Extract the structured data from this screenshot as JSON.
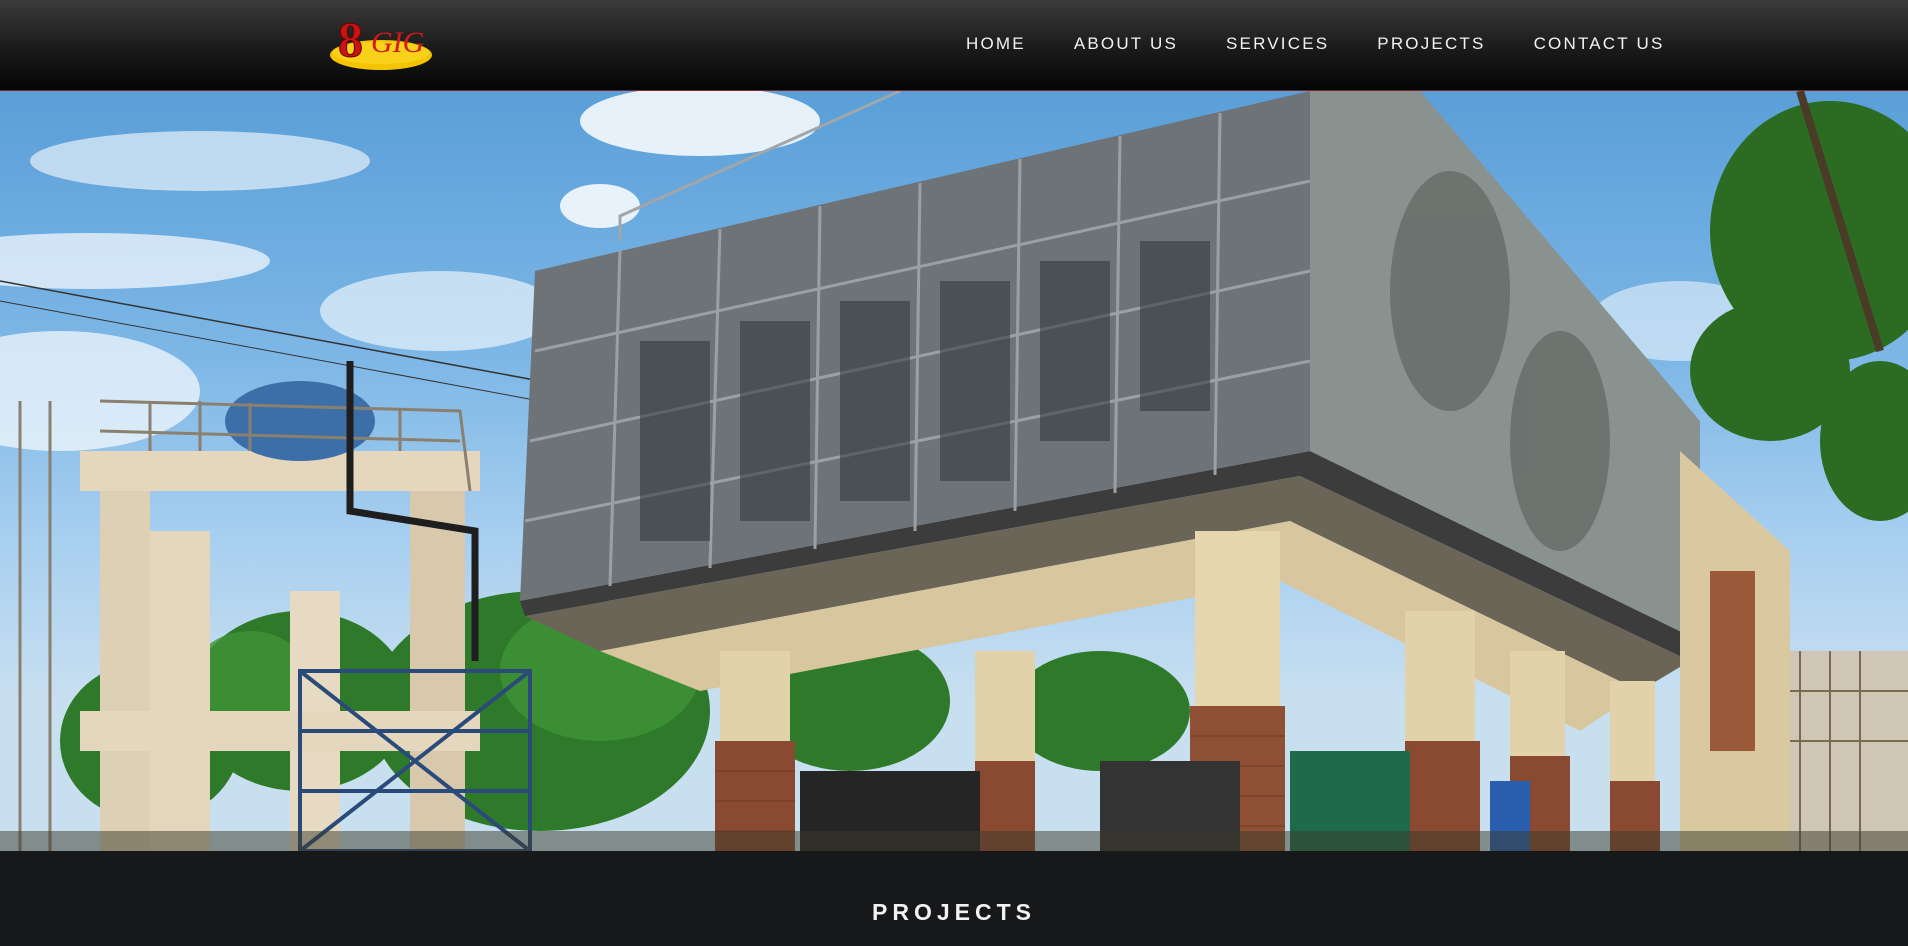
{
  "header": {
    "logo_text": "GIG",
    "logo_digit": "8",
    "nav": [
      {
        "label": "HOME"
      },
      {
        "label": "ABOUT US"
      },
      {
        "label": "SERVICES"
      },
      {
        "label": "PROJECTS"
      },
      {
        "label": "CONTACT US"
      }
    ]
  },
  "hero": {
    "image_icon": "building-photo"
  },
  "section": {
    "title": "PROJECTS"
  },
  "colors": {
    "nav_bg": "#1a1a1a",
    "nav_text": "#f2f2f2",
    "logo_red": "#d41a1a",
    "logo_yellow": "#f5c400",
    "section_bg": "#17181a"
  }
}
